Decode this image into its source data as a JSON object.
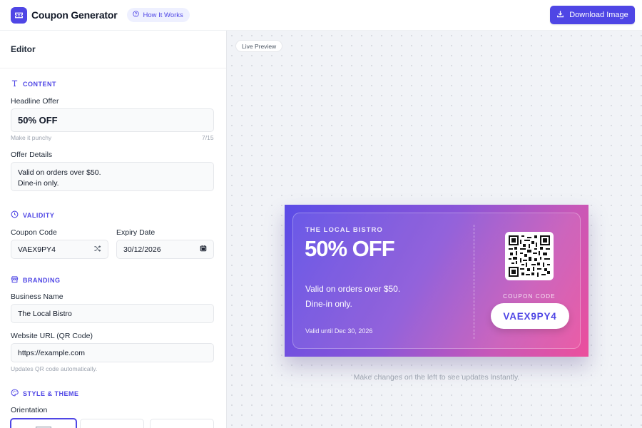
{
  "header": {
    "title": "Coupon Generator",
    "how_it_works": "How It Works",
    "download": "Download Image"
  },
  "editor": {
    "title": "Editor",
    "sections": {
      "content": "CONTENT",
      "validity": "VALIDITY",
      "branding": "BRANDING",
      "style": "STYLE & THEME"
    },
    "headline_label": "Headline Offer",
    "headline_value": "50% OFF",
    "headline_hint": "Make it punchy",
    "headline_count": "7/15",
    "details_label": "Offer Details",
    "details_value": "Valid on orders over $50.\nDine-in only.",
    "code_label": "Coupon Code",
    "code_value": "VAEX9PY4",
    "expiry_label": "Expiry Date",
    "expiry_value": "30/12/2026",
    "business_label": "Business Name",
    "business_value": "The Local Bistro",
    "url_label": "Website URL (QR Code)",
    "url_value": "https://example.com",
    "url_hint": "Updates QR code automatically.",
    "orientation_label": "Orientation"
  },
  "preview": {
    "live_label": "Live Preview",
    "hint": "Make changes on the left to see updates instantly.",
    "coupon": {
      "business": "THE LOCAL BISTRO",
      "headline": "50% OFF",
      "details": "Valid on orders over $50.\nDine-in only.",
      "valid_until": "Valid until Dec 30, 2026",
      "code_label": "COUPON CODE",
      "code": "VAEX9PY4"
    }
  },
  "colors": {
    "accent": "#4f46e5",
    "coupon_gradient_start": "#5b4ce6",
    "coupon_gradient_end": "#ec4f9c"
  },
  "icons": [
    "ticket-icon",
    "help-circle-icon",
    "download-icon",
    "text-icon",
    "clock-icon",
    "calendar-icon",
    "shuffle-icon",
    "store-icon",
    "palette-icon",
    "qr-code-icon"
  ]
}
